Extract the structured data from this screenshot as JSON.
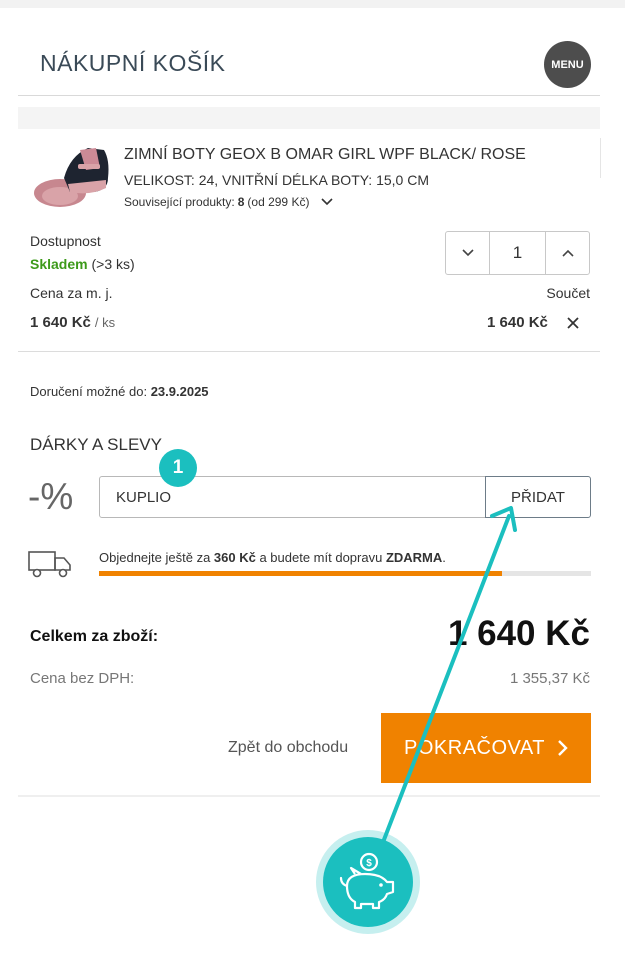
{
  "header": {
    "title": "NÁKUPNÍ KOŠÍK",
    "menu_label": "MENU"
  },
  "product": {
    "name": "ZIMNÍ BOTY GEOX B OMAR GIRL WPF BLACK/ ROSE",
    "variant": "VELIKOST: 24, VNITŘNÍ DÉLKA BOTY: 15,0 CM",
    "related_label": "Související produkty:",
    "related_count": "8",
    "related_from": "(od 299 Kč)",
    "availability_label": "Dostupnost",
    "stock_status": "Skladem",
    "stock_qty": "(>3 ks)",
    "quantity": "1",
    "unit_price_label": "Cena za m. j.",
    "sum_label": "Součet",
    "unit_price": "1 640 Kč",
    "unit_per": "/ ks",
    "sum_price": "1 640 Kč"
  },
  "delivery": {
    "label": "Doručení možné do:",
    "date": "23.9.2025"
  },
  "gifts": {
    "title": "DÁRKY A SLEVY",
    "percent_symbol": "-%",
    "coupon_value": "KUPLIO",
    "add_label": "PŘIDAT",
    "step_number": "1"
  },
  "shipping": {
    "text_before": "Objednejte ještě za",
    "amount": "360 Kč",
    "text_middle": "a budete mít dopravu",
    "free_word": "ZDARMA",
    "text_end": ".",
    "progress_fraction": 0.82
  },
  "totals": {
    "label": "Celkem za zboží:",
    "value": "1 640 Kč",
    "vat_label": "Cena bez DPH:",
    "vat_value": "1 355,37 Kč"
  },
  "actions": {
    "back_label": "Zpět do obchodu",
    "continue_label": "POKRAČOVAT"
  },
  "colors": {
    "accent": "#f08200",
    "teal": "#1bbfbf",
    "stock_green": "#3d9a1a"
  },
  "icons": [
    "menu-icon",
    "chevron-down-icon",
    "minus-chevron-icon",
    "plus-chevron-icon",
    "close-icon",
    "truck-icon",
    "chevron-right-icon",
    "piggy-bank-icon"
  ]
}
